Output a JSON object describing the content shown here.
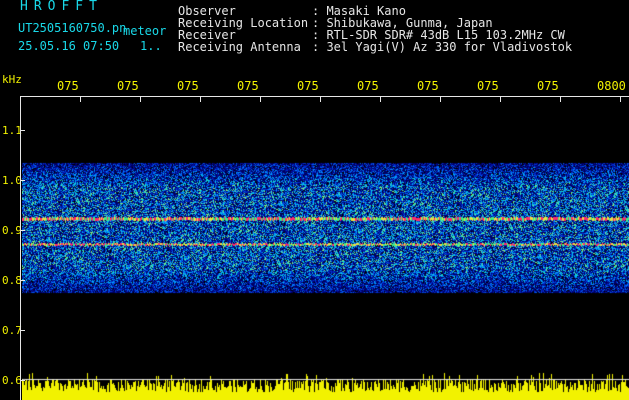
{
  "logo": "HROFFT",
  "file_name": "UT2505160750.pn",
  "meteor_label": "meteor",
  "date_time": "25.05.16 07:50",
  "date_time_value": "1..",
  "header": [
    {
      "label": "Observer",
      "value": ": Masaki Kano"
    },
    {
      "label": "Receiving Location",
      "value": ": Shibukawa, Gunma, Japan"
    },
    {
      "label": "Receiver",
      "value": ": RTL-SDR SDR# 43dB L15 103.2MHz CW"
    },
    {
      "label": "Receiving Antenna",
      "value": ": 3el Yagi(V) Az 330 for Vladivostok"
    }
  ],
  "freq_unit": "kHz",
  "time_ticks": [
    "075",
    "075",
    "075",
    "075",
    "075",
    "075",
    "075",
    "075",
    "075",
    "0800"
  ],
  "freq_ticks": [
    "1.1",
    "1.0",
    "0.9",
    "0.8",
    "0.7",
    "0.6"
  ],
  "colors": {
    "text_cyan": "#19d8e8",
    "text_green": "#1ef03a",
    "text_white": "#e6e6e6",
    "power_bar": "#f2f200",
    "echo_line": "#ff2a6a",
    "background": "#000000"
  }
}
